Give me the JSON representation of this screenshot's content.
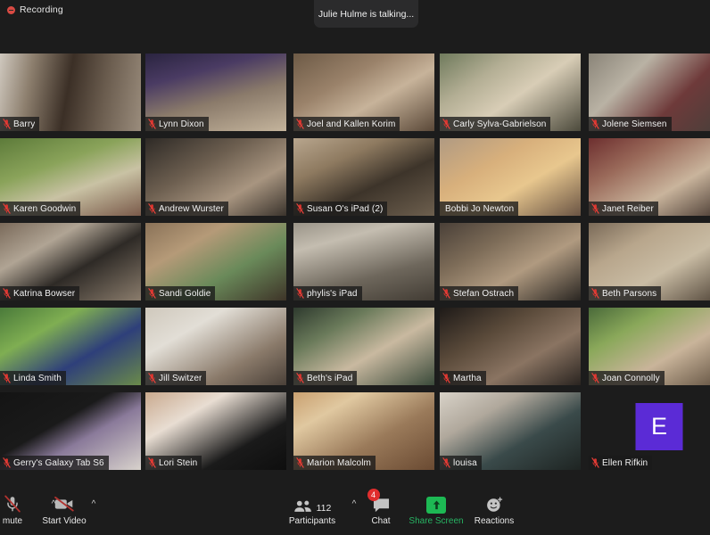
{
  "app": {
    "name": "Zoom Meeting",
    "background_color": "#1c1c1c"
  },
  "topbar": {
    "recording_label": "Recording",
    "recording_icon": "recording-dot-icon",
    "talking_banner": "Julie Hulme is talking..."
  },
  "grid": {
    "columns": 5,
    "rows": [
      [
        {
          "name": "Barry",
          "muted": true,
          "avatar": null,
          "bg": "linear-gradient(100deg,#cfc8be 0%,#8d7f6e 22%,#3b2f26 48%,#6a5c4e 72%,#9a8c7c 100%)"
        },
        {
          "name": "Lynn Dixon",
          "muted": true,
          "avatar": null,
          "bg": "linear-gradient(165deg,#2a2440 0%,#4a3b63 28%,#8a7a6a 58%,#c4b49c 100%)"
        },
        {
          "name": "Joel and Kallen  Korim",
          "muted": true,
          "avatar": null,
          "bg": "linear-gradient(150deg,#6d5a46 0%,#9a826a 35%,#c7b39a 60%,#5a4838 100%)"
        },
        {
          "name": "Carly Sylva-Gabrielson",
          "muted": true,
          "avatar": null,
          "bg": "linear-gradient(145deg,#6f7a5c 0%,#b3ae94 30%,#d8cdb6 55%,#4c4a3c 100%)"
        },
        {
          "name": "Jolene Siemsen",
          "muted": true,
          "avatar": null,
          "bg": "linear-gradient(135deg,#8a8478 0%,#b9b2a4 30%,#6e3a3a 62%,#45403a 100%)"
        }
      ],
      [
        {
          "name": "Karen Goodwin",
          "muted": true,
          "avatar": null,
          "bg": "linear-gradient(160deg,#5d7b3a 0%,#8aa35a 35%,#c9c2a4 62%,#7a5a4a 100%)"
        },
        {
          "name": "Andrew Wurster",
          "muted": true,
          "avatar": null,
          "bg": "linear-gradient(150deg,#2e2a26 0%,#6d5f50 38%,#a89580 68%,#3a332c 100%)"
        },
        {
          "name": "Susan O's iPad (2)",
          "muted": true,
          "avatar": null,
          "bg": "linear-gradient(155deg,#b8a68e 0%,#8e7a60 30%,#3d342a 60%,#6d5f4e 100%)"
        },
        {
          "name": "Bobbi Jo Newton",
          "muted": false,
          "avatar": null,
          "bg": "linear-gradient(150deg,#b09a82 0%,#d8b07c 35%,#e8c78e 60%,#6a5444 100%)"
        },
        {
          "name": "Janet Reiber",
          "muted": true,
          "avatar": null,
          "bg": "linear-gradient(150deg,#6d2f2f 0%,#9a6a5a 30%,#c9b49c 62%,#3d2f28 100%)"
        }
      ],
      [
        {
          "name": "Katrina Bowser",
          "muted": true,
          "avatar": null,
          "bg": "linear-gradient(150deg,#7a6a5a 0%,#b0a494 30%,#2e2a26 58%,#8a7c6c 100%)"
        },
        {
          "name": "Sandi Goldie",
          "muted": true,
          "avatar": null,
          "bg": "linear-gradient(150deg,#8a7258 0%,#b59a78 30%,#6a8a5a 62%,#3e3428 100%)"
        },
        {
          "name": "phylis's iPad",
          "muted": true,
          "avatar": null,
          "bg": "linear-gradient(165deg,#9a9488 0%,#c4bdb0 25%,#6e675c 65%,#423c34 100%)"
        },
        {
          "name": "Stefan Ostrach",
          "muted": true,
          "avatar": null,
          "bg": "linear-gradient(150deg,#4a4038 0%,#7d6c58 32%,#b09a80 60%,#2a2622 100%)"
        },
        {
          "name": "Beth Parsons",
          "muted": true,
          "avatar": null,
          "bg": "linear-gradient(150deg,#7a6a58 0%,#b8a68c 30%,#c9bca4 58%,#4a3e32 100%)"
        }
      ],
      [
        {
          "name": "Linda Smith",
          "muted": true,
          "avatar": null,
          "bg": "linear-gradient(150deg,#4a7a3a 0%,#7fae52 30%,#2e3f7a 62%,#6a8a4a 100%)"
        },
        {
          "name": "Jill Switzer",
          "muted": true,
          "avatar": null,
          "bg": "linear-gradient(150deg,#cfc8bc 0%,#e2ded6 30%,#8a7a6a 70%,#4a4038 100%)"
        },
        {
          "name": "Beth's iPad",
          "muted": true,
          "avatar": null,
          "bg": "linear-gradient(150deg,#2e3a2e 0%,#6a7a5a 28%,#c9b9a0 58%,#3a4a3a 100%)"
        },
        {
          "name": "Martha",
          "muted": true,
          "avatar": null,
          "bg": "linear-gradient(150deg,#1e1a18 0%,#5a4a3a 35%,#8a7462 65%,#2a2420 100%)"
        },
        {
          "name": "Joan Connolly",
          "muted": true,
          "avatar": null,
          "bg": "linear-gradient(150deg,#4a6a3a 0%,#8aa85a 28%,#c9b49a 60%,#5a4a3a 100%)"
        }
      ],
      [
        {
          "name": "Gerry's Galaxy Tab S6",
          "muted": true,
          "avatar": null,
          "bg": "linear-gradient(150deg,#141414 0%,#1a1a1a 40%,#8a7a9a 60%,#d8d2cc 100%)"
        },
        {
          "name": "Lori Stein",
          "muted": true,
          "avatar": null,
          "bg": "linear-gradient(150deg,#c9a98e 0%,#e8ddd2 30%,#1a1a1a 70%,#0e0e0e 100%)"
        },
        {
          "name": "Marion Malcolm",
          "muted": true,
          "avatar": null,
          "bg": "linear-gradient(150deg,#c9a070 0%,#e0c8a0 25%,#9a7a5a 60%,#6a4a32 100%)"
        },
        {
          "name": "louisa",
          "muted": true,
          "avatar": null,
          "bg": "linear-gradient(150deg,#d8d2c8 0%,#b0a89c 30%,#3a4a4a 62%,#1e2422 100%)"
        },
        {
          "name": "Ellen Rifkin",
          "muted": true,
          "avatar": {
            "letter": "E",
            "color": "#5b2bd6"
          },
          "bg": "#1c1c1c"
        }
      ]
    ]
  },
  "toolbar": {
    "items": [
      {
        "id": "mute",
        "label": "mute",
        "icon": "mic-muted-icon",
        "caret": true
      },
      {
        "id": "video",
        "label": "Start Video",
        "icon": "video-off-icon",
        "caret": true
      },
      {
        "id": "participants",
        "label": "Participants",
        "icon": "participants-icon",
        "count": "112",
        "caret": true
      },
      {
        "id": "chat",
        "label": "Chat",
        "icon": "chat-icon",
        "badge": "4",
        "caret": false
      },
      {
        "id": "share",
        "label": "Share Screen",
        "icon": "share-screen-icon",
        "caret": false,
        "accent": "#1db954"
      },
      {
        "id": "reactions",
        "label": "Reactions",
        "icon": "reactions-icon",
        "caret": false
      }
    ]
  }
}
